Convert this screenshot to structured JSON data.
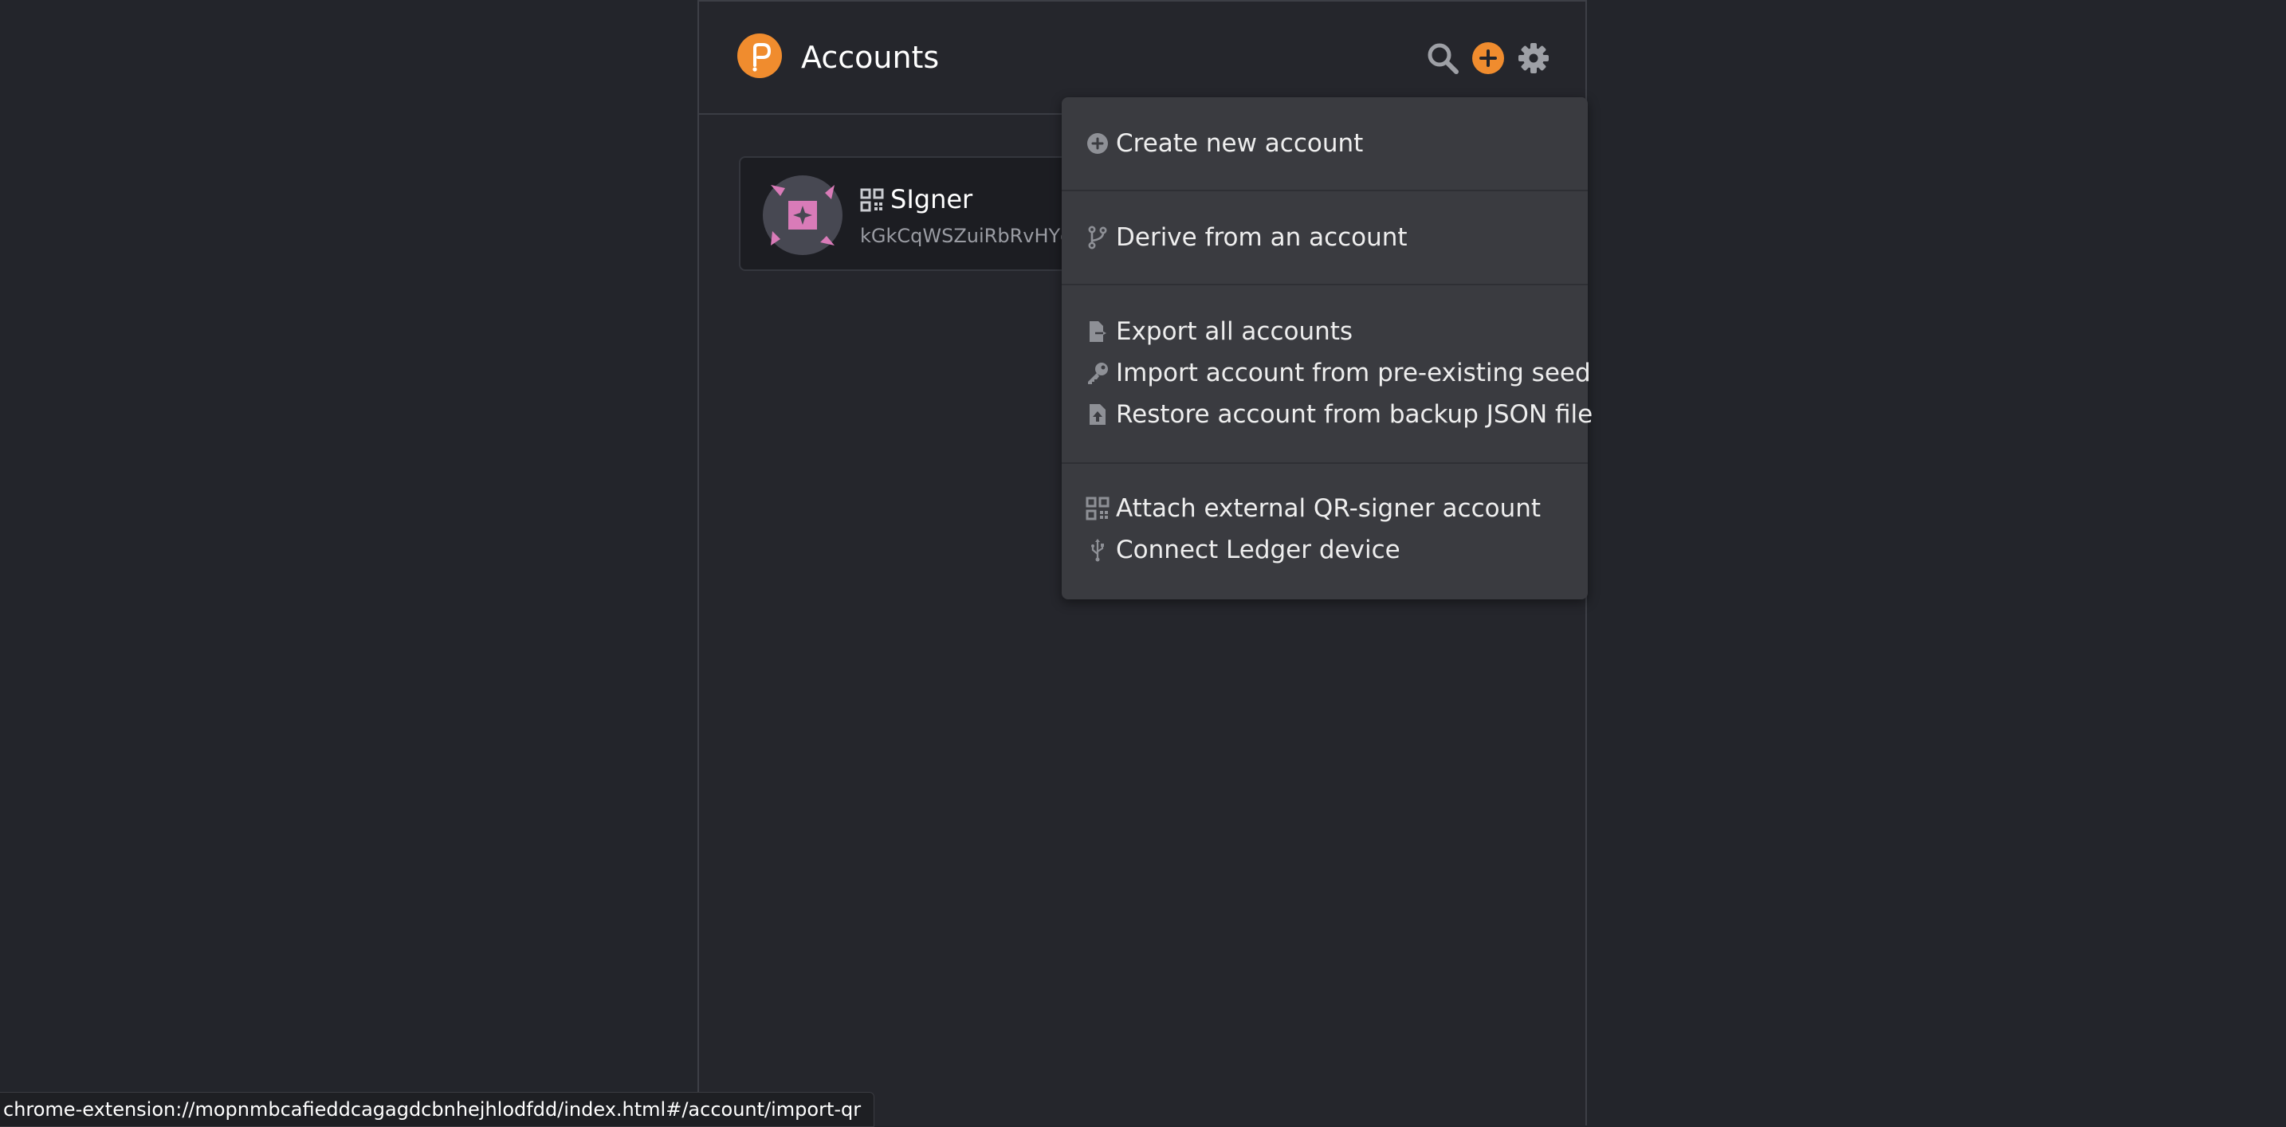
{
  "header": {
    "title": "Accounts",
    "logo_icon": "polkadot-logo-icon",
    "search_icon": "search-icon",
    "add_icon": "add-icon",
    "settings_icon": "gear-icon"
  },
  "account": {
    "name": "SIgner",
    "address": "kGkCqWSZuiRbRvHYqe",
    "type_icon": "qr-code-icon",
    "avatar_icon": "identicon"
  },
  "menu": {
    "sections": [
      {
        "items": [
          {
            "label": "Create new account",
            "icon": "plus-circle-icon"
          }
        ]
      },
      {
        "items": [
          {
            "label": "Derive from an account",
            "icon": "code-branch-icon"
          }
        ]
      },
      {
        "items": [
          {
            "label": "Export all accounts",
            "icon": "file-export-icon"
          },
          {
            "label": "Import account from pre-existing seed",
            "icon": "key-icon"
          },
          {
            "label": "Restore account from backup JSON file",
            "icon": "file-upload-icon"
          }
        ]
      },
      {
        "items": [
          {
            "label": "Attach external QR-signer account",
            "icon": "qr-code-icon"
          },
          {
            "label": "Connect Ledger device",
            "icon": "usb-icon"
          }
        ]
      }
    ]
  },
  "status_bar": {
    "url": "chrome-extension://mopnmbcafieddcagagdcbnhejhlodfdd/index.html#/account/import-qr"
  },
  "colors": {
    "background": "#23252b",
    "popup_background": "#25262c",
    "menu_background": "#3a3b40",
    "accent_orange": "#f08c2e",
    "identicon_pink": "#d97bb8",
    "text_primary": "#ffffff",
    "text_secondary": "#9a9ca3"
  }
}
